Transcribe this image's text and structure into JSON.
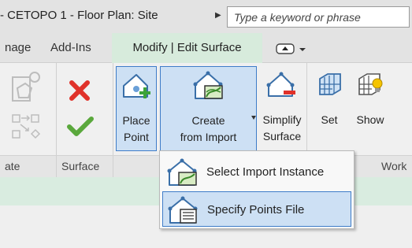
{
  "window": {
    "title": "- CETOPO 1 - Floor Plan: Site",
    "search_placeholder": "Type a keyword or phrase"
  },
  "tabs": [
    {
      "label": "nage"
    },
    {
      "label": "Add-Ins"
    },
    {
      "label": "Modify | Edit Surface",
      "active": true
    }
  ],
  "ribbon": {
    "buttons": {
      "place_point": {
        "line1": "Place",
        "line2": "Point"
      },
      "create_from_import": {
        "line1": "Create",
        "line2": "from Import"
      },
      "simplify_surface": {
        "line1": "Simplify",
        "line2": "Surface"
      },
      "set": {
        "label": "Set"
      },
      "show": {
        "label": "Show"
      }
    },
    "panel_labels": {
      "left": "ate",
      "surface": "Surface",
      "work": "Work"
    }
  },
  "dropdown": {
    "items": [
      {
        "label": "Select Import Instance",
        "icon": "select-import-icon"
      },
      {
        "label": "Specify Points File",
        "icon": "points-file-icon",
        "highlighted": true
      }
    ]
  },
  "colors": {
    "active_tab": "#d7ebdc",
    "selection_fill": "#cde0f4",
    "selection_border": "#3e7cc8",
    "cancel_red": "#e0322a",
    "finish_green": "#5aa83c"
  }
}
